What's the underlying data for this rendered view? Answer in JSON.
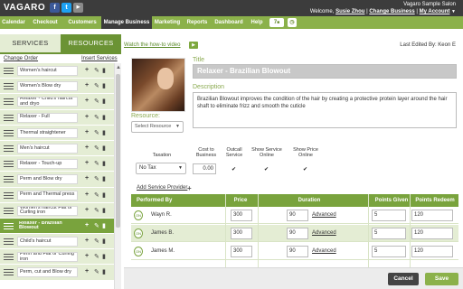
{
  "topbar": {
    "logo": "VAGARO",
    "salon": "Vagaro Sample Salon",
    "welcome_prefix": "Welcome,",
    "user": "Susie Zhou",
    "sep1": "|",
    "change_business": "Change Business",
    "sep2": "|",
    "my_account": "My Account"
  },
  "nav": {
    "items": [
      "Calendar",
      "Checkout",
      "Customers",
      "Manage Business",
      "Marketing",
      "Reports",
      "Dashboard",
      "Help"
    ],
    "active": "Manage Business",
    "badge": "7"
  },
  "left": {
    "tab_services": "SERVICES",
    "tab_resources": "RESOURCES",
    "change_order": "Change Order",
    "insert_services": "Insert Services",
    "services": [
      "Women's haircut",
      "Women's Blow dry",
      "Relaxer - Child's haircut and dryo",
      "Relaxer - Full",
      "Thermal straightener",
      "Men's haircut",
      "Relaxer - Touch-up",
      "Perm and Blow dry",
      "Perm and Thermal press",
      "Women's haircut Flat or Curling iron",
      "Relaxer - Brazilian Blowout",
      "Child's haircut",
      "Perm and Flat or Curling iron",
      "Perm, cut and Blow dry"
    ],
    "selected_index": 10
  },
  "detail": {
    "video_link": "Watch the how-to video",
    "last_edited": "Last Edited By: Keon E",
    "resource_label": "Resource:",
    "resource_placeholder": "Select Resource",
    "title_label": "Title",
    "title_value": "Relaxer - Brazilian Blowout",
    "description_label": "Description",
    "description_value": "Brazilian Blowout improves the condition of the hair by creating a protective protein layer around the hair shaft to eliminate frizz and smooth the cuticle",
    "col_taxation": "Taxation",
    "col_cost": "Cost to Business",
    "col_outcall": "Outcall Service",
    "col_show_service": "Show Service Online",
    "col_show_price": "Show Price Online",
    "tax_value": "No Tax",
    "cost_value": "0.00",
    "add_provider": "Add Service Provider"
  },
  "table": {
    "headers": [
      "Performed By",
      "Price",
      "Duration",
      "Points Given",
      "Points Redeem"
    ],
    "advanced_label": "Advanced",
    "rows": [
      {
        "name": "Wayn R.",
        "price": "300",
        "duration": "90",
        "points_given": "5",
        "points_redeem": "120"
      },
      {
        "name": "James B.",
        "price": "300",
        "duration": "90",
        "points_given": "5",
        "points_redeem": "120"
      },
      {
        "name": "James M.",
        "price": "300",
        "duration": "90",
        "points_given": "5",
        "points_redeem": "120"
      }
    ]
  },
  "footer": {
    "cancel": "Cancel",
    "save": "Save"
  },
  "colors": {
    "brand_green": "#8bb14a",
    "dark_bar": "#3c3c3c",
    "light_green": "#e4edd4"
  }
}
